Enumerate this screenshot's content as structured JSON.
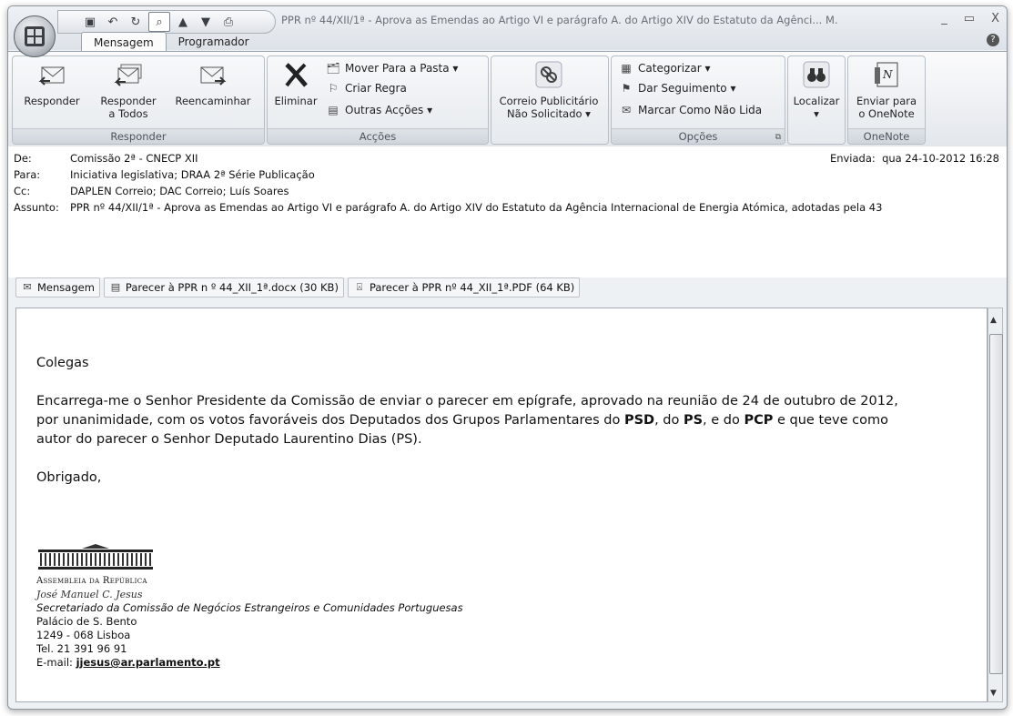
{
  "window": {
    "title": "PPR nº 44/XII/1ª - Aprova as Emendas ao Artigo VI e parágrafo A. do Artigo XIV do Estatuto da Agênci... M.",
    "controls": [
      "_",
      "▭",
      "X"
    ]
  },
  "tabs": [
    {
      "label": "Mensagem",
      "active": true
    },
    {
      "label": "Programador",
      "active": false
    }
  ],
  "ribbon": {
    "responder": {
      "label": "Responder",
      "buttons": [
        {
          "name": "reply",
          "label1": "Responder",
          "label2": ""
        },
        {
          "name": "reply-all",
          "label1": "Responder",
          "label2": "a Todos"
        },
        {
          "name": "forward",
          "label1": "Reencaminhar",
          "label2": ""
        }
      ]
    },
    "accoes": {
      "label": "Acções",
      "delete": "Eliminar",
      "move": "Mover Para a Pasta ▾",
      "rule": "Criar Regra",
      "other": "Outras Acções ▾"
    },
    "junk": {
      "line1": "Correio Publicitário",
      "line2": "Não Solicitado ▾"
    },
    "opcoes": {
      "label": "Opções",
      "categorize": "Categorizar ▾",
      "followup": "Dar Seguimento ▾",
      "unread": "Marcar Como Não Lida"
    },
    "find": {
      "label": "Localizar",
      "sub": "▾"
    },
    "onenote": {
      "label": "OneNote",
      "line1": "Enviar para",
      "line2": "o OneNote"
    }
  },
  "header": {
    "from_label": "De:",
    "from": "Comissão 2ª - CNECP XII",
    "to_label": "Para:",
    "to": "Iniciativa legislativa; DRAA 2ª Série Publicação",
    "cc_label": "Cc:",
    "cc": "DAPLEN Correio; DAC Correio; Luís Soares",
    "subject_label": "Assunto:",
    "subject": "PPR nº 44/XII/1ª - Aprova as Emendas ao Artigo VI e parágrafo A. do Artigo XIV do Estatuto da Agência Internacional de Energia Atómica, adotadas pela 43",
    "sent_label": "Enviada:",
    "sent": "qua 24-10-2012 16:28"
  },
  "attachments": [
    {
      "name": "Mensagem"
    },
    {
      "name": "Parecer à PPR n º 44_XII_1ª.docx (30 KB)"
    },
    {
      "name": "Parecer à PPR nº 44_XII_1ª.PDF (64 KB)"
    }
  ],
  "body": {
    "greeting": "Colegas",
    "p1a": "Encarrega-me o Senhor Presidente da Comissão de enviar o parecer em epígrafe, aprovado na reunião de 24 de outubro de 2012,",
    "p1b_1": "por unanimidade, com os votos favoráveis dos Deputados dos Grupos Parlamentares do ",
    "psd": "PSD",
    "p1b_2": ", do ",
    "ps": "PS",
    "p1b_3": ", e do ",
    "pcp": "PCP",
    "p1b_4": " e que teve como",
    "p1c": "autor do parecer o Senhor Deputado Laurentino Dias (PS).",
    "closing": "Obrigado,"
  },
  "signature": {
    "org": "Assembleia da República",
    "name": "José Manuel C. Jesus",
    "dept": "Secretariado da Comissão de Negócios Estrangeiros e Comunidades Portuguesas",
    "addr1": "Palácio de S. Bento",
    "addr2": "1249 - 068  Lisboa",
    "tel": "Tel. 21 391 96 91",
    "email_label": "E-mail: ",
    "email": "jjesus@ar.parlamento.pt"
  }
}
